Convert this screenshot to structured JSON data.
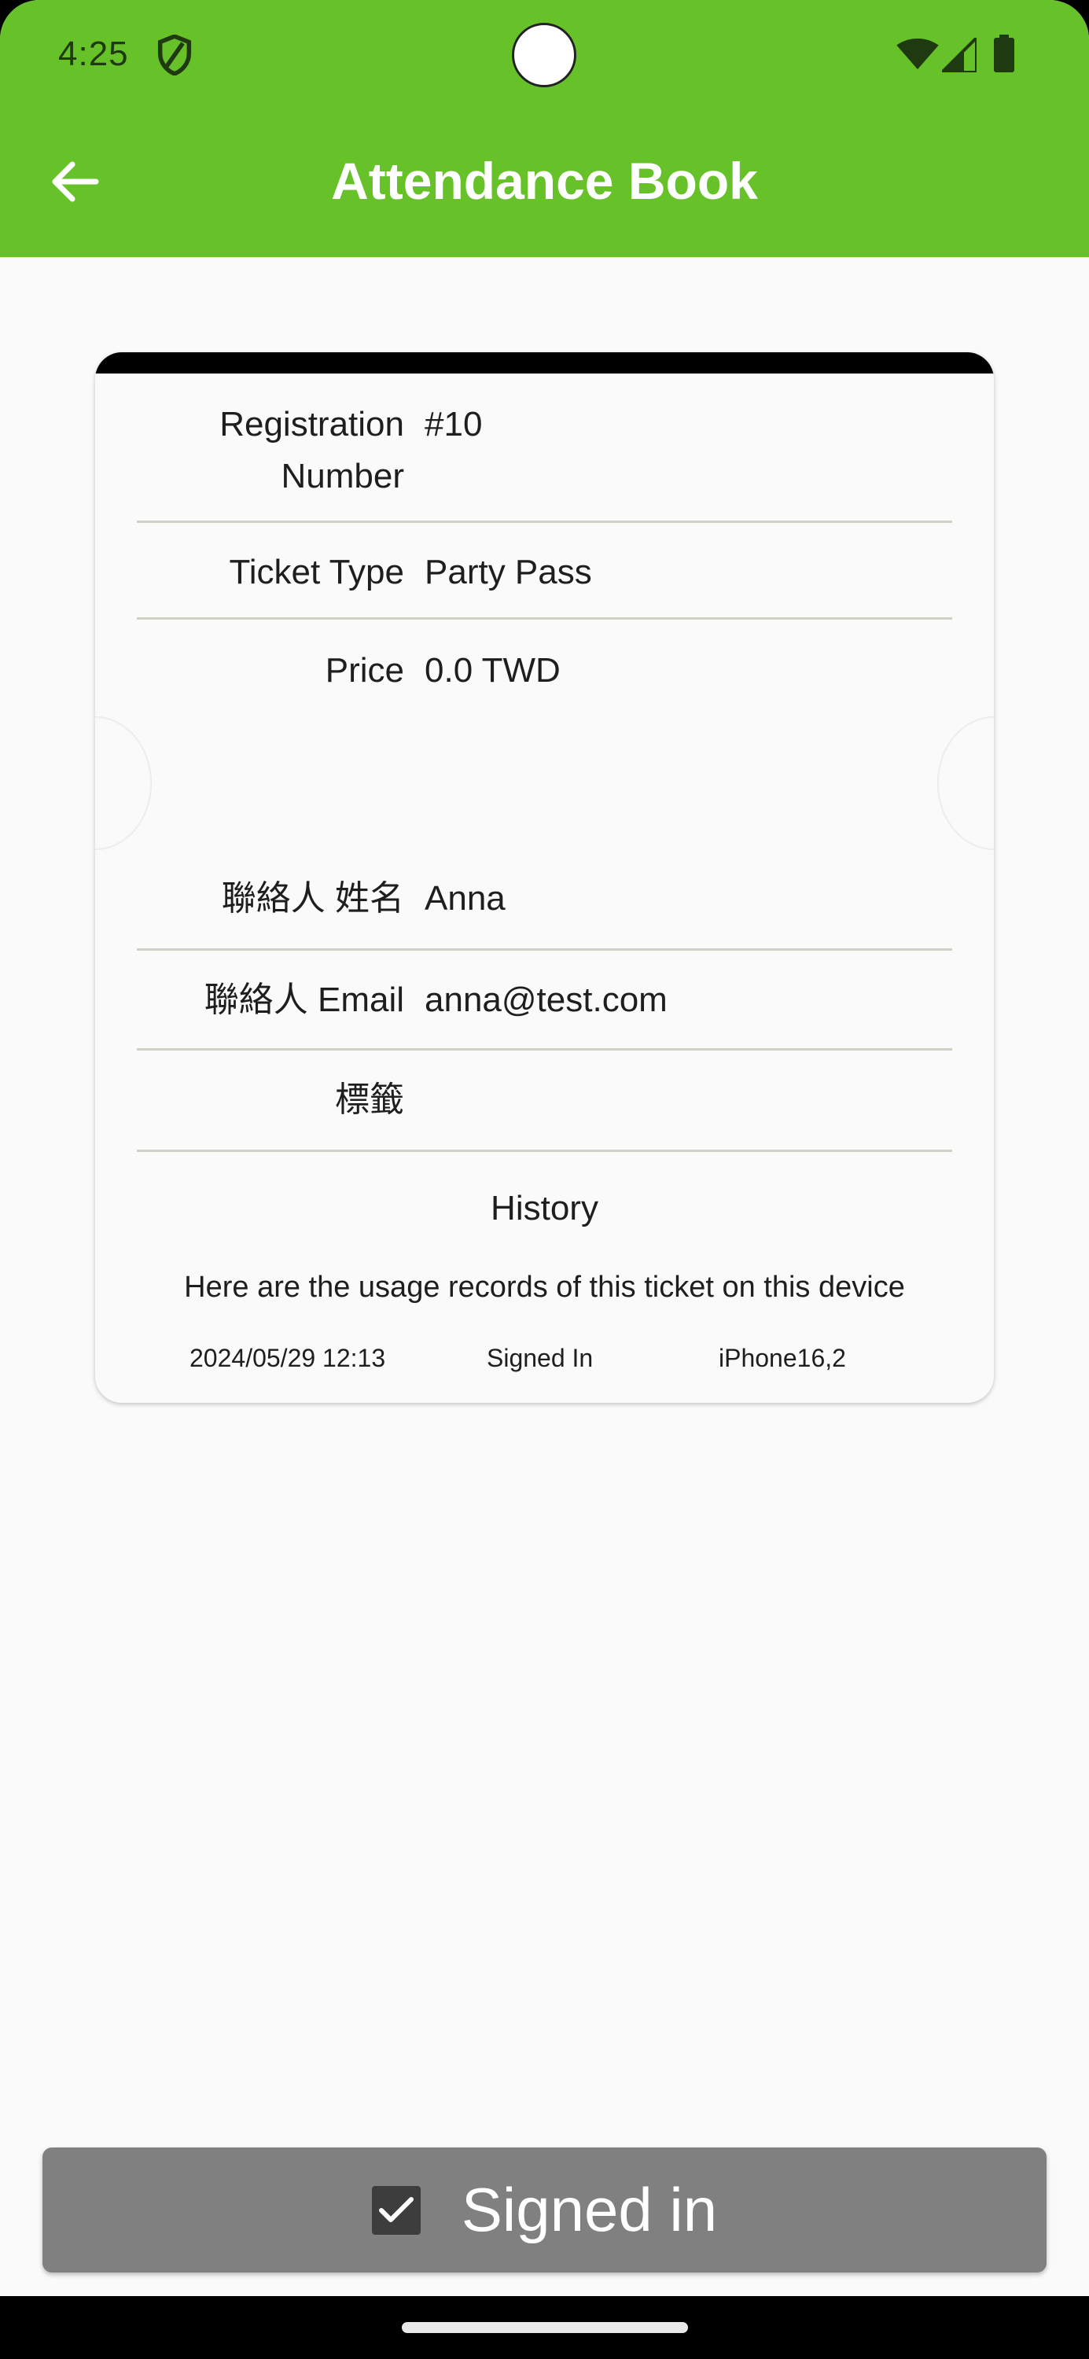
{
  "status_bar": {
    "time": "4:25"
  },
  "app_bar": {
    "title": "Attendance Book"
  },
  "ticket": {
    "fields": [
      {
        "label_line1": "Registration",
        "label_line2": "Number",
        "value": "#10"
      },
      {
        "label": "Ticket Type",
        "value": "Party Pass"
      },
      {
        "label": "Price",
        "value": "0.0 TWD"
      },
      {
        "label": "聯絡人 姓名",
        "value": "Anna"
      },
      {
        "label": "聯絡人 Email",
        "value": "anna@test.com"
      },
      {
        "label": "標籤",
        "value": ""
      }
    ],
    "history": {
      "title": "History",
      "description": "Here are the usage records of this ticket on this device",
      "records": [
        {
          "time": "2024/05/29 12:13",
          "action": "Signed In",
          "device": "iPhone16,2"
        }
      ]
    }
  },
  "bottom_button": {
    "label": "Signed in"
  },
  "colors": {
    "primary": "#67c22a",
    "button": "#808080",
    "divider": "#cfcfc4"
  }
}
